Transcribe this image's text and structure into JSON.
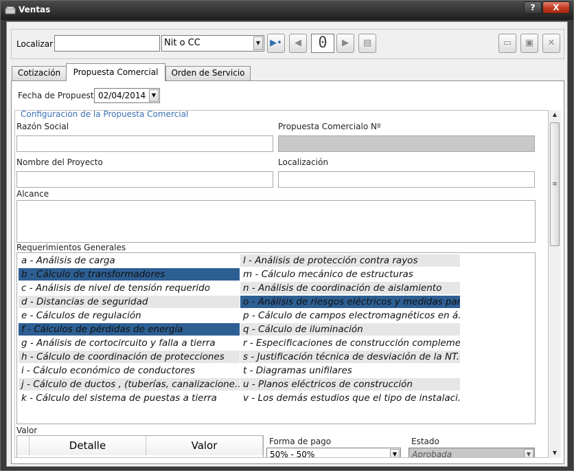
{
  "window": {
    "title": "Ventas",
    "help_label": "?",
    "close_label": "X"
  },
  "toolbar": {
    "localizar_label": "Localizar",
    "localizar_value": "",
    "doc_type": "Nit o CC",
    "counter_value": "0"
  },
  "tabs": [
    {
      "label": "Cotización"
    },
    {
      "label": "Propuesta Comercial"
    },
    {
      "label": "Orden de Servicio"
    }
  ],
  "form": {
    "fecha_label": "Fecha de Propuesta",
    "fecha_value": "02/04/2014",
    "group_title": "Configuración de la Propuesta Comercial",
    "razon_social_label": "Razón Social",
    "razon_social_value": "",
    "propuesta_label": "Propuesta Comercialo Nº",
    "propuesta_value": "",
    "proyecto_label": "Nombre del Proyecto",
    "proyecto_value": "",
    "localizacion_label": "Localización",
    "localizacion_value": "",
    "alcance_label": "Alcance",
    "alcance_value": "",
    "requerimientos_label": "Requerimientos Generales",
    "valor_label": "Valor",
    "forma_pago_label": "Forma de pago",
    "forma_pago_value": "50% - 50%",
    "estado_label": "Estado",
    "estado_value": "Aprobada"
  },
  "requirements_left": [
    {
      "text": "a - Análisis de carga",
      "state": "normal"
    },
    {
      "text": "b - Cálculo de transformadores",
      "state": "selected"
    },
    {
      "text": "c - Análisis de nivel de tensión requerido",
      "state": "normal"
    },
    {
      "text": "d - Distancias de seguridad",
      "state": "alt"
    },
    {
      "text": "e - Cálculos de regulación",
      "state": "normal"
    },
    {
      "text": "f - Cálculos de pérdidas de energía",
      "state": "selected"
    },
    {
      "text": "g - Análisis de cortocircuito y falla a tierra",
      "state": "normal"
    },
    {
      "text": "h - Cálculo de coordinación de protecciones",
      "state": "alt"
    },
    {
      "text": "i - Cálculo económico de conductores",
      "state": "normal"
    },
    {
      "text": "j - Cálculo de ductos , (tuberías, canalizacione...",
      "state": "alt"
    },
    {
      "text": "k - Cálculo del sistema de puestas a tierra",
      "state": "normal"
    }
  ],
  "requirements_right": [
    {
      "text": "l - Análisis de protección contra rayos",
      "state": "alt"
    },
    {
      "text": "m - Cálculo mecánico de estructuras",
      "state": "normal"
    },
    {
      "text": "n - Análisis de coordinación de aislamiento",
      "state": "alt"
    },
    {
      "text": "o - Análisis de riesgos eléctricos y medidas par...",
      "state": "selected"
    },
    {
      "text": "p - Cálculo de campos electromagnéticos en á...",
      "state": "normal"
    },
    {
      "text": "q - Cálculo de iluminación",
      "state": "alt"
    },
    {
      "text": "r - Especificaciones de construcción compleme...",
      "state": "normal"
    },
    {
      "text": "s - Justificación técnica de desviación de la NT...",
      "state": "alt"
    },
    {
      "text": "t - Diagramas unifilares",
      "state": "normal"
    },
    {
      "text": "u - Planos eléctricos de construcción",
      "state": "alt"
    },
    {
      "text": "v - Los demás estudios que el tipo de instalaci...",
      "state": "normal"
    }
  ],
  "valor_grid": {
    "columns": [
      "Detalle",
      "Valor"
    ]
  }
}
